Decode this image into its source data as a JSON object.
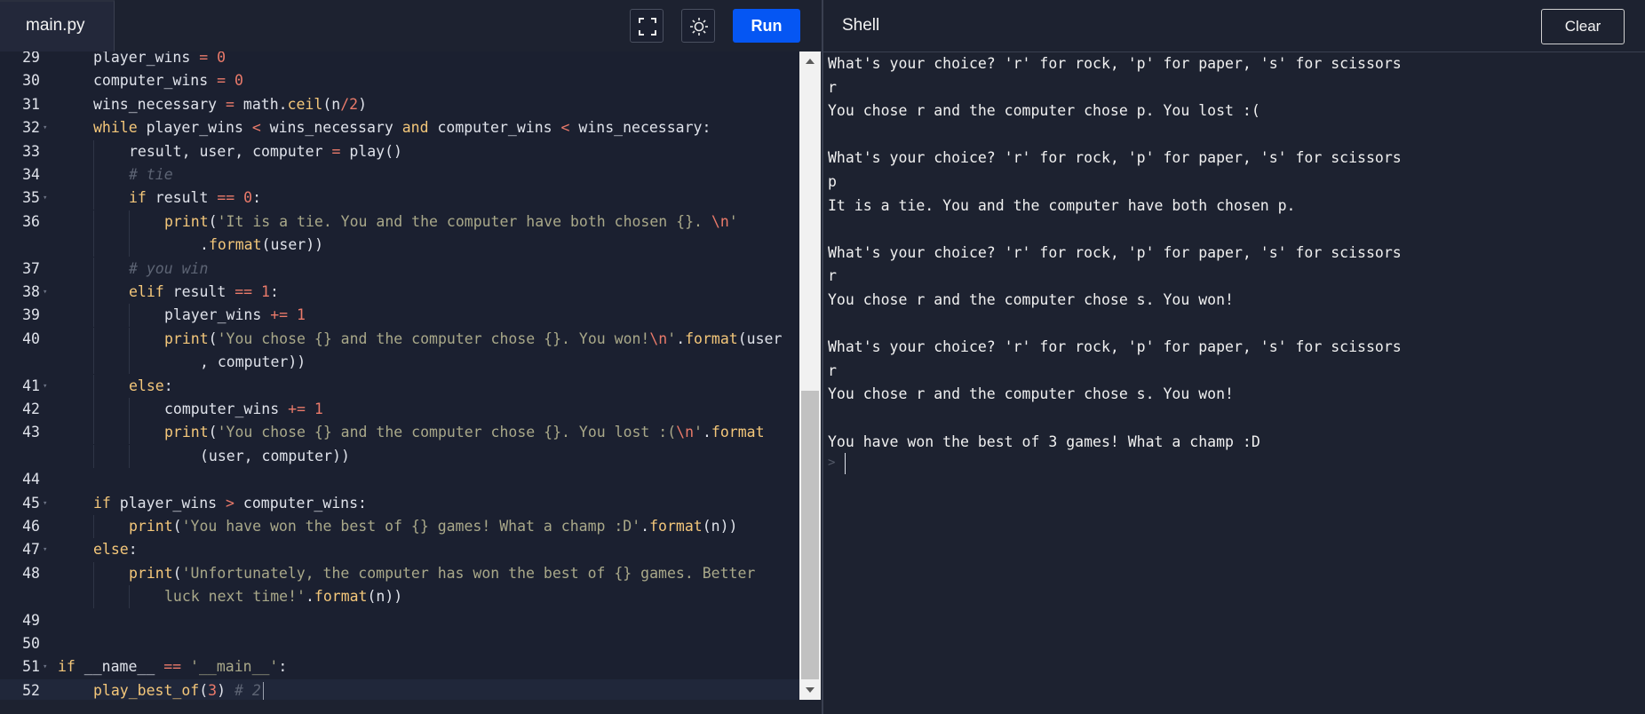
{
  "editor": {
    "tab_label": "main.py",
    "fullscreen_icon": "fullscreen-icon",
    "theme_icon": "sun-icon",
    "run_label": "Run"
  },
  "code_lines": [
    {
      "ln": "29",
      "fold": false,
      "cont": false,
      "indent": 1,
      "tokens": [
        [
          "player_wins ",
          ""
        ],
        [
          "=",
          "op"
        ],
        [
          " ",
          ""
        ],
        [
          "0",
          "num"
        ]
      ]
    },
    {
      "ln": "30",
      "fold": false,
      "cont": false,
      "indent": 1,
      "tokens": [
        [
          "computer_wins ",
          ""
        ],
        [
          "=",
          "op"
        ],
        [
          " ",
          ""
        ],
        [
          "0",
          "num"
        ]
      ]
    },
    {
      "ln": "31",
      "fold": false,
      "cont": false,
      "indent": 1,
      "tokens": [
        [
          "wins_necessary ",
          ""
        ],
        [
          "=",
          "op"
        ],
        [
          " math.",
          ""
        ],
        [
          "ceil",
          "fn"
        ],
        [
          "(n",
          ""
        ],
        [
          "/",
          "op"
        ],
        [
          "2",
          "num"
        ],
        [
          ")",
          ""
        ]
      ]
    },
    {
      "ln": "32",
      "fold": true,
      "cont": false,
      "indent": 1,
      "tokens": [
        [
          "while",
          "kw"
        ],
        [
          " player_wins ",
          ""
        ],
        [
          "<",
          "op"
        ],
        [
          " wins_necessary ",
          ""
        ],
        [
          "and",
          "kw"
        ],
        [
          " computer_wins ",
          ""
        ],
        [
          "<",
          "op"
        ],
        [
          " wins_necessary:",
          ""
        ]
      ]
    },
    {
      "ln": "33",
      "fold": false,
      "cont": false,
      "indent": 2,
      "tokens": [
        [
          "result, user, computer ",
          ""
        ],
        [
          "=",
          "op"
        ],
        [
          " play()",
          ""
        ]
      ]
    },
    {
      "ln": "34",
      "fold": false,
      "cont": false,
      "indent": 2,
      "tokens": [
        [
          "# tie",
          "cm"
        ]
      ]
    },
    {
      "ln": "35",
      "fold": true,
      "cont": false,
      "indent": 2,
      "tokens": [
        [
          "if",
          "kw"
        ],
        [
          " result ",
          ""
        ],
        [
          "==",
          "op"
        ],
        [
          " ",
          ""
        ],
        [
          "0",
          "num"
        ],
        [
          ":",
          ""
        ]
      ]
    },
    {
      "ln": "36",
      "fold": false,
      "cont": false,
      "indent": 3,
      "tokens": [
        [
          "print",
          "fn"
        ],
        [
          "(",
          ""
        ],
        [
          "'It is a tie. You and the computer have both chosen {}. ",
          "str"
        ],
        [
          "\\n",
          "esc"
        ],
        [
          "'",
          "str"
        ]
      ]
    },
    {
      "ln": "",
      "fold": false,
      "cont": true,
      "indent": 4,
      "tokens": [
        [
          ".",
          ""
        ],
        [
          "format",
          "fn"
        ],
        [
          "(user))",
          ""
        ]
      ]
    },
    {
      "ln": "37",
      "fold": false,
      "cont": false,
      "indent": 2,
      "tokens": [
        [
          "# you win",
          "cm"
        ]
      ]
    },
    {
      "ln": "38",
      "fold": true,
      "cont": false,
      "indent": 2,
      "tokens": [
        [
          "elif",
          "kw"
        ],
        [
          " result ",
          ""
        ],
        [
          "==",
          "op"
        ],
        [
          " ",
          ""
        ],
        [
          "1",
          "num"
        ],
        [
          ":",
          ""
        ]
      ]
    },
    {
      "ln": "39",
      "fold": false,
      "cont": false,
      "indent": 3,
      "tokens": [
        [
          "player_wins ",
          ""
        ],
        [
          "+=",
          "op"
        ],
        [
          " ",
          ""
        ],
        [
          "1",
          "num"
        ]
      ]
    },
    {
      "ln": "40",
      "fold": false,
      "cont": false,
      "indent": 3,
      "tokens": [
        [
          "print",
          "fn"
        ],
        [
          "(",
          ""
        ],
        [
          "'You chose {} and the computer chose {}. You won!",
          "str"
        ],
        [
          "\\n",
          "esc"
        ],
        [
          "'",
          "str"
        ],
        [
          ".",
          ""
        ],
        [
          "format",
          "fn"
        ],
        [
          "(user",
          ""
        ]
      ]
    },
    {
      "ln": "",
      "fold": false,
      "cont": true,
      "indent": 4,
      "tokens": [
        [
          ", computer))",
          ""
        ]
      ]
    },
    {
      "ln": "41",
      "fold": true,
      "cont": false,
      "indent": 2,
      "tokens": [
        [
          "else",
          "kw"
        ],
        [
          ":",
          ""
        ]
      ]
    },
    {
      "ln": "42",
      "fold": false,
      "cont": false,
      "indent": 3,
      "tokens": [
        [
          "computer_wins ",
          ""
        ],
        [
          "+=",
          "op"
        ],
        [
          " ",
          ""
        ],
        [
          "1",
          "num"
        ]
      ]
    },
    {
      "ln": "43",
      "fold": false,
      "cont": false,
      "indent": 3,
      "tokens": [
        [
          "print",
          "fn"
        ],
        [
          "(",
          ""
        ],
        [
          "'You chose {} and the computer chose {}. You lost :(",
          "str"
        ],
        [
          "\\n",
          "esc"
        ],
        [
          "'",
          "str"
        ],
        [
          ".",
          ""
        ],
        [
          "format",
          "fn"
        ]
      ]
    },
    {
      "ln": "",
      "fold": false,
      "cont": true,
      "indent": 4,
      "tokens": [
        [
          "(user, computer))",
          ""
        ]
      ]
    },
    {
      "ln": "44",
      "fold": false,
      "cont": false,
      "indent": 0,
      "tokens": []
    },
    {
      "ln": "45",
      "fold": true,
      "cont": false,
      "indent": 1,
      "tokens": [
        [
          "if",
          "kw"
        ],
        [
          " player_wins ",
          ""
        ],
        [
          ">",
          "op"
        ],
        [
          " computer_wins:",
          ""
        ]
      ]
    },
    {
      "ln": "46",
      "fold": false,
      "cont": false,
      "indent": 2,
      "tokens": [
        [
          "print",
          "fn"
        ],
        [
          "(",
          ""
        ],
        [
          "'You have won the best of {} games! What a champ :D'",
          "str"
        ],
        [
          ".",
          ""
        ],
        [
          "format",
          "fn"
        ],
        [
          "(n))",
          ""
        ]
      ]
    },
    {
      "ln": "47",
      "fold": true,
      "cont": false,
      "indent": 1,
      "tokens": [
        [
          "else",
          "kw"
        ],
        [
          ":",
          ""
        ]
      ]
    },
    {
      "ln": "48",
      "fold": false,
      "cont": false,
      "indent": 2,
      "tokens": [
        [
          "print",
          "fn"
        ],
        [
          "(",
          ""
        ],
        [
          "'Unfortunately, the computer has won the best of {} games. Better",
          "str"
        ]
      ]
    },
    {
      "ln": "",
      "fold": false,
      "cont": true,
      "indent": 3,
      "tokens": [
        [
          "luck next time!'",
          "str"
        ],
        [
          ".",
          ""
        ],
        [
          "format",
          "fn"
        ],
        [
          "(n))",
          ""
        ]
      ]
    },
    {
      "ln": "49",
      "fold": false,
      "cont": false,
      "indent": 0,
      "tokens": []
    },
    {
      "ln": "50",
      "fold": false,
      "cont": false,
      "indent": 0,
      "tokens": []
    },
    {
      "ln": "51",
      "fold": true,
      "cont": false,
      "indent": 0,
      "tokens": [
        [
          "if",
          "kw"
        ],
        [
          " __name__ ",
          ""
        ],
        [
          "==",
          "op"
        ],
        [
          " ",
          ""
        ],
        [
          "'__main__'",
          "str"
        ],
        [
          ":",
          ""
        ]
      ]
    },
    {
      "ln": "52",
      "fold": false,
      "cont": false,
      "indent": 1,
      "current": true,
      "tokens": [
        [
          "play_best_of",
          "fn"
        ],
        [
          "(",
          ""
        ],
        [
          "3",
          "num"
        ],
        [
          ") ",
          ""
        ],
        [
          "# 2",
          "cm"
        ]
      ]
    }
  ],
  "shell": {
    "title": "Shell",
    "clear_label": "Clear",
    "prompt_symbol": ">",
    "output_lines": [
      "What's your choice? 'r' for rock, 'p' for paper, 's' for scissors",
      "r",
      "You chose r and the computer chose p. You lost :(",
      "",
      "What's your choice? 'r' for rock, 'p' for paper, 's' for scissors",
      "p",
      "It is a tie. You and the computer have both chosen p.",
      "",
      "What's your choice? 'r' for rock, 'p' for paper, 's' for scissors",
      "r",
      "You chose r and the computer chose s. You won!",
      "",
      "What's your choice? 'r' for rock, 'p' for paper, 's' for scissors",
      "r",
      "You chose r and the computer chose s. You won!",
      "",
      "You have won the best of 3 games! What a champ :D"
    ]
  }
}
